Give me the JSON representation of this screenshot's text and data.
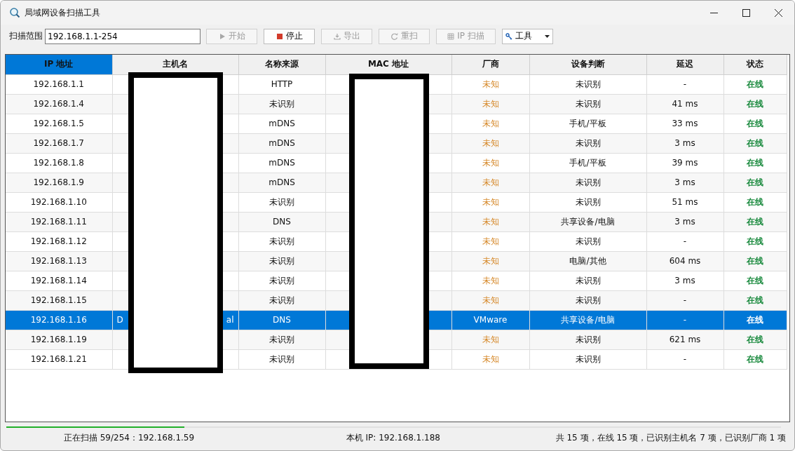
{
  "window": {
    "title": "局域网设备扫描工具"
  },
  "toolbar": {
    "range_label": "扫描范围",
    "range_value": "192.168.1.1-254",
    "buttons": [
      {
        "label": "开始",
        "kind": "play",
        "disabled": true
      },
      {
        "label": "停止",
        "kind": "stop",
        "disabled": false
      },
      {
        "label": "导出",
        "kind": "export",
        "disabled": true
      },
      {
        "label": "重扫",
        "kind": "refresh",
        "disabled": true
      },
      {
        "label": "IP 扫描",
        "kind": "grid",
        "disabled": true
      }
    ],
    "tools_menu": {
      "label": "工具"
    }
  },
  "table": {
    "columns": [
      "IP 地址",
      "主机名",
      "名称来源",
      "MAC 地址",
      "厂商",
      "设备判断",
      "延迟",
      "状态"
    ],
    "rows": [
      {
        "ip": "192.168.1.1",
        "source": "HTTP",
        "vendor": "未知",
        "vendor_identified": false,
        "device": "未识别",
        "latency": "-",
        "status": "在线",
        "online": true,
        "selected": false
      },
      {
        "ip": "192.168.1.4",
        "source": "未识别",
        "vendor": "未知",
        "vendor_identified": false,
        "device": "未识别",
        "latency": "41 ms",
        "status": "在线",
        "online": true,
        "selected": false
      },
      {
        "ip": "192.168.1.5",
        "source": "mDNS",
        "vendor": "未知",
        "vendor_identified": false,
        "device": "手机/平板",
        "latency": "33 ms",
        "status": "在线",
        "online": true,
        "selected": false
      },
      {
        "ip": "192.168.1.7",
        "source": "mDNS",
        "vendor": "未知",
        "vendor_identified": false,
        "device": "未识别",
        "latency": "3 ms",
        "status": "在线",
        "online": true,
        "selected": false
      },
      {
        "ip": "192.168.1.8",
        "source": "mDNS",
        "vendor": "未知",
        "vendor_identified": false,
        "device": "手机/平板",
        "latency": "39 ms",
        "status": "在线",
        "online": true,
        "selected": false
      },
      {
        "ip": "192.168.1.9",
        "source": "mDNS",
        "vendor": "未知",
        "vendor_identified": false,
        "device": "未识别",
        "latency": "3 ms",
        "status": "在线",
        "online": true,
        "selected": false
      },
      {
        "ip": "192.168.1.10",
        "source": "未识别",
        "vendor": "未知",
        "vendor_identified": false,
        "device": "未识别",
        "latency": "51 ms",
        "status": "在线",
        "online": true,
        "selected": false
      },
      {
        "ip": "192.168.1.11",
        "source": "DNS",
        "vendor": "未知",
        "vendor_identified": false,
        "device": "共享设备/电脑",
        "latency": "3 ms",
        "status": "在线",
        "online": true,
        "selected": false
      },
      {
        "ip": "192.168.1.12",
        "source": "未识别",
        "vendor": "未知",
        "vendor_identified": false,
        "device": "未识别",
        "latency": "-",
        "status": "在线",
        "online": true,
        "selected": false
      },
      {
        "ip": "192.168.1.13",
        "source": "未识别",
        "vendor": "未知",
        "vendor_identified": false,
        "device": "电脑/其他",
        "latency": "604 ms",
        "status": "在线",
        "online": true,
        "selected": false
      },
      {
        "ip": "192.168.1.14",
        "source": "未识别",
        "vendor": "未知",
        "vendor_identified": false,
        "device": "未识别",
        "latency": "3 ms",
        "status": "在线",
        "online": true,
        "selected": false
      },
      {
        "ip": "192.168.1.15",
        "source": "未识别",
        "vendor": "未知",
        "vendor_identified": false,
        "device": "未识别",
        "latency": "-",
        "status": "在线",
        "online": true,
        "selected": false
      },
      {
        "ip": "192.168.1.16",
        "host_parts": [
          "D",
          "al"
        ],
        "source": "DNS",
        "vendor": "VMware",
        "vendor_identified": true,
        "device": "共享设备/电脑",
        "latency": "-",
        "status": "在线",
        "online": true,
        "selected": true
      },
      {
        "ip": "192.168.1.19",
        "source": "未识别",
        "vendor": "未知",
        "vendor_identified": false,
        "device": "未识别",
        "latency": "621 ms",
        "status": "在线",
        "online": true,
        "selected": false
      },
      {
        "ip": "192.168.1.21",
        "source": "未识别",
        "vendor": "未知",
        "vendor_identified": false,
        "device": "未识别",
        "latency": "-",
        "status": "在线",
        "online": true,
        "selected": false
      }
    ]
  },
  "status_bar": {
    "progress": {
      "level": 0.23
    },
    "scan_text": "正在扫描 59/254：192.168.1.59",
    "local_ip": "本机 IP: 192.168.1.188",
    "summary": "共 15 项，在线 15 项，已识别主机名 7 项，已识别厂商 1 项"
  }
}
